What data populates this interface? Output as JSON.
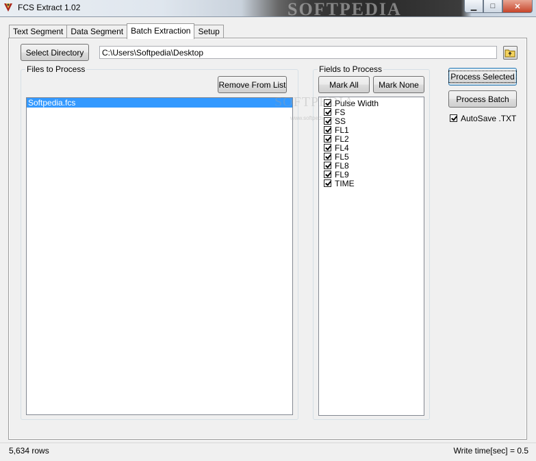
{
  "window": {
    "title": "FCS Extract 1.02",
    "watermark": "SOFTPEDIA",
    "minimize_glyph": "▁",
    "maximize_glyph": "□",
    "close_glyph": "✕"
  },
  "tabs": [
    {
      "label": "Text Segment",
      "active": false
    },
    {
      "label": "Data Segment",
      "active": false
    },
    {
      "label": "Batch Extraction",
      "active": true
    },
    {
      "label": "Setup",
      "active": false
    }
  ],
  "directory": {
    "select_label": "Select Directory",
    "path": "C:\\Users\\Softpedia\\Desktop",
    "folder_icon": "folder-up-icon"
  },
  "files": {
    "group_label": "Files to Process",
    "remove_label": "Remove From List",
    "items": [
      "Softpedia.fcs"
    ]
  },
  "fields": {
    "group_label": "Fields to Process",
    "mark_all_label": "Mark All",
    "mark_none_label": "Mark None",
    "items": [
      {
        "label": "Pulse Width",
        "checked": true
      },
      {
        "label": "FS",
        "checked": true
      },
      {
        "label": "SS",
        "checked": true
      },
      {
        "label": "FL1",
        "checked": true
      },
      {
        "label": "FL2",
        "checked": true
      },
      {
        "label": "FL4",
        "checked": true
      },
      {
        "label": "FL5",
        "checked": true
      },
      {
        "label": "FL8",
        "checked": true
      },
      {
        "label": "FL9",
        "checked": true
      },
      {
        "label": "TIME",
        "checked": true
      }
    ]
  },
  "actions": {
    "process_selected_label": "Process Selected",
    "process_batch_label": "Process Batch",
    "autosave_label": "AutoSave .TXT",
    "autosave_checked": true
  },
  "watermark_body": {
    "main": "SOFTPEDIA",
    "sub": "www.softpedia.com"
  },
  "status": {
    "rows": "5,634 rows",
    "write_time": "Write time[sec] = 0.5"
  },
  "colors": {
    "selection": "#3399ff",
    "window_bg": "#f0f0f0"
  }
}
